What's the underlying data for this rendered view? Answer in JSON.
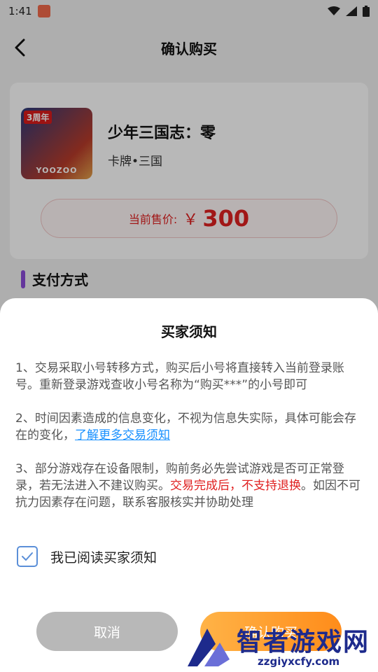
{
  "status_bar": {
    "time": "1:41",
    "app_icon": "app-notification-icon"
  },
  "header": {
    "title": "确认购买",
    "back_icon": "back-arrow-icon"
  },
  "game": {
    "name": "少年三国志：零",
    "tags": "卡牌•三国",
    "icon_badge": "3周年",
    "icon_brand": "YOOZOO"
  },
  "price": {
    "label": "当前售价:",
    "currency": "￥",
    "value": "300"
  },
  "payment_section": {
    "title": "支付方式"
  },
  "sheet": {
    "title": "买家须知",
    "notice_1": "1、交易采取小号转移方式，购买后小号将直接转入当前登录账号。重新登录游戏查收小号名称为“购买***”的小号即可",
    "notice_2_text": "2、时间因素造成的信息变化，不视为信息失实际，具体可能会存在的变化，",
    "notice_2_link": "了解更多交易须知",
    "notice_3_text": "3、部分游戏存在设备限制，购前务必先尝试游戏是否可正常登录，若无法进入不建议购买。",
    "notice_3_warning": "交易完成后，不支持退换",
    "notice_3_tail": "。如因不可抗力因素存在问题，联系客服核实并协助处理",
    "agree_label": "我已阅读买家须知",
    "agree_checked": true,
    "cancel_label": "取消",
    "confirm_label": "确认购买"
  },
  "watermark": {
    "text": "智者游戏网",
    "url": "zzgiyxcfy.com"
  },
  "colors": {
    "accent": "#8b4bd8",
    "price_red": "#e02020",
    "link_blue": "#1890ff",
    "confirm_orange": "#ff9a2e"
  }
}
